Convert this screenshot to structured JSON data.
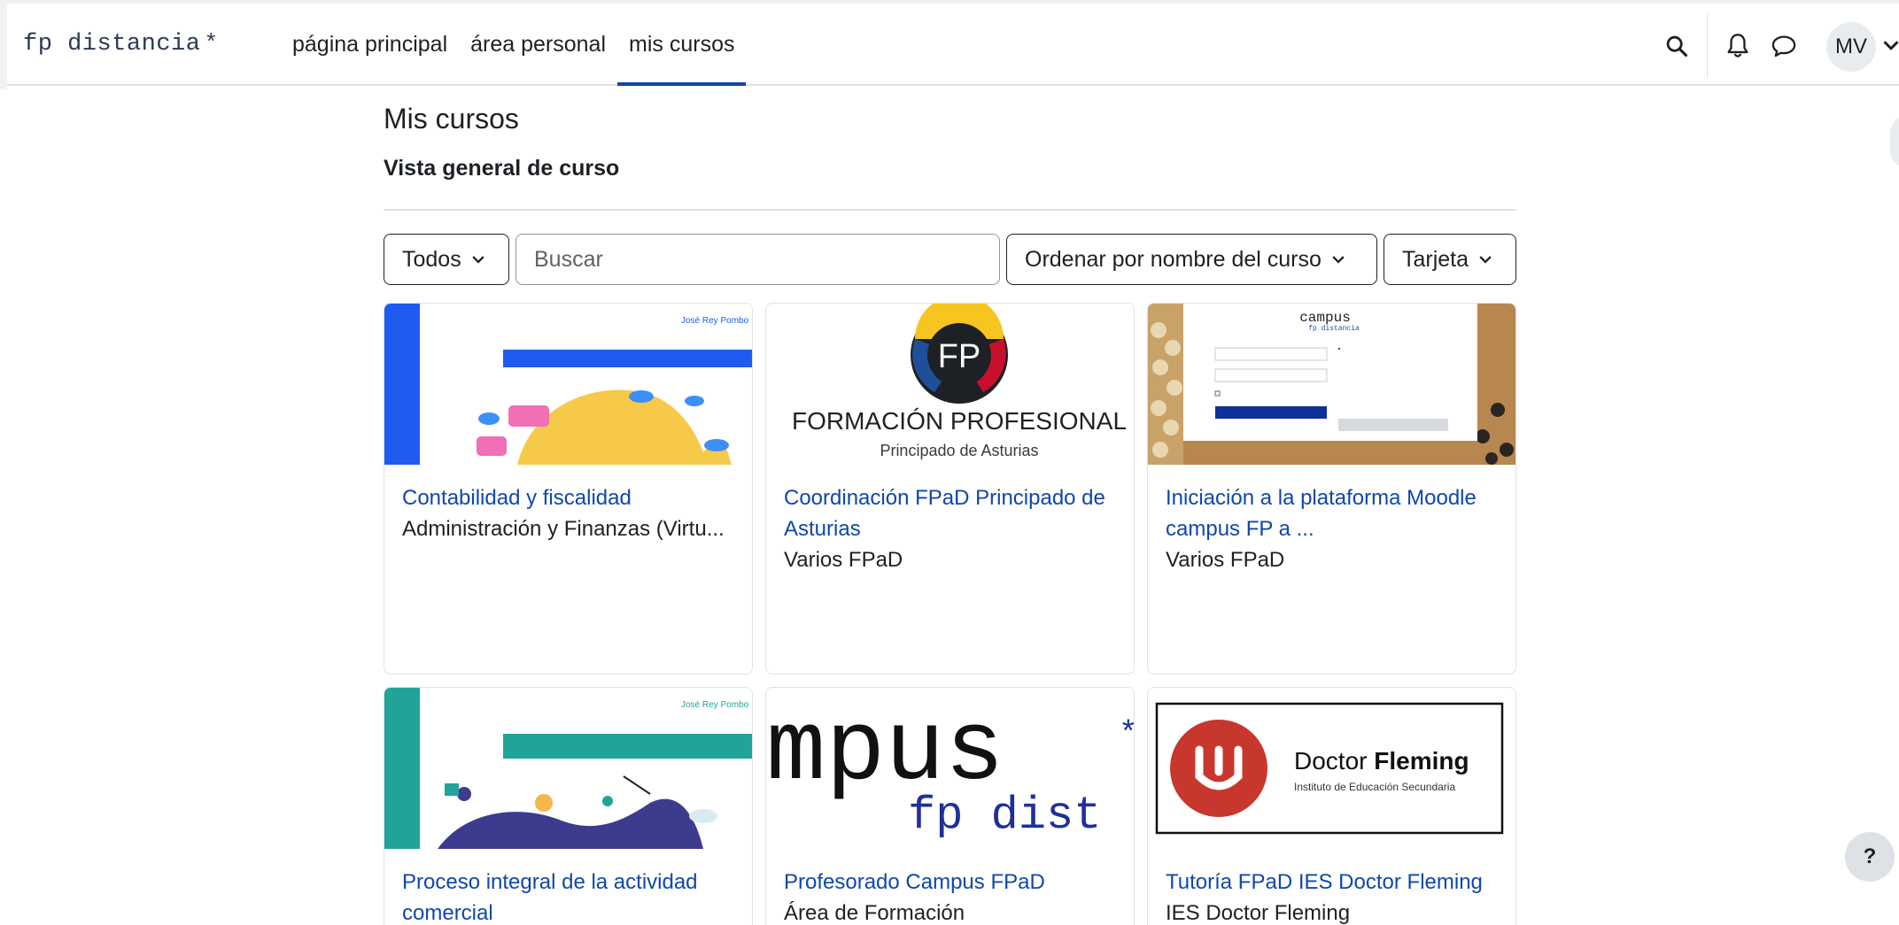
{
  "navbar": {
    "brand": "fp distancia",
    "brand_star": "*",
    "links": [
      {
        "label": "página principal",
        "active": false
      },
      {
        "label": "área personal",
        "active": false
      },
      {
        "label": "mis cursos",
        "active": true
      }
    ],
    "icons": [
      "search-icon",
      "bell-icon",
      "chat-bubble-icon"
    ],
    "user_initials": "MV"
  },
  "page": {
    "title": "Mis cursos",
    "section_title": "Vista general de curso"
  },
  "filters": {
    "grouping": "Todos",
    "search_placeholder": "Buscar",
    "sort": "Ordenar por nombre del curso",
    "view": "Tarjeta"
  },
  "courses": [
    {
      "name": "Contabilidad y fiscalidad",
      "category": "Administración y Finanzas (Virtu...",
      "image_text": "José Rey Pombo"
    },
    {
      "name": "Coordinación FPaD Principado de Asturias",
      "category": "Varios FPaD",
      "image_text": "FORMACIÓN PROFESIONAL",
      "image_subtext": "Principado de Asturias",
      "image_logo": "FP"
    },
    {
      "name": "Iniciación a la plataforma Moodle campus FP a ...",
      "category": "Varios FPaD",
      "image_text": "campus",
      "image_subtext": "fp distancia"
    },
    {
      "name": "Proceso integral de la actividad comercial",
      "category": "",
      "image_text": "José Rey Pombo"
    },
    {
      "name": "Profesorado Campus FPaD",
      "category": "Área de Formación",
      "image_text": "mpus",
      "image_subtext": "fp dist"
    },
    {
      "name": "Tutoría FPaD IES Doctor Fleming",
      "category": "IES Doctor Fleming",
      "image_text": "Doctor",
      "image_text_bold": "Fleming",
      "image_subtext": "Instituto de Educación Secundaria"
    }
  ],
  "help_label": "?",
  "colors": {
    "link": "#0f47ad",
    "text": "#1d2125",
    "border": "#dee2e6"
  }
}
